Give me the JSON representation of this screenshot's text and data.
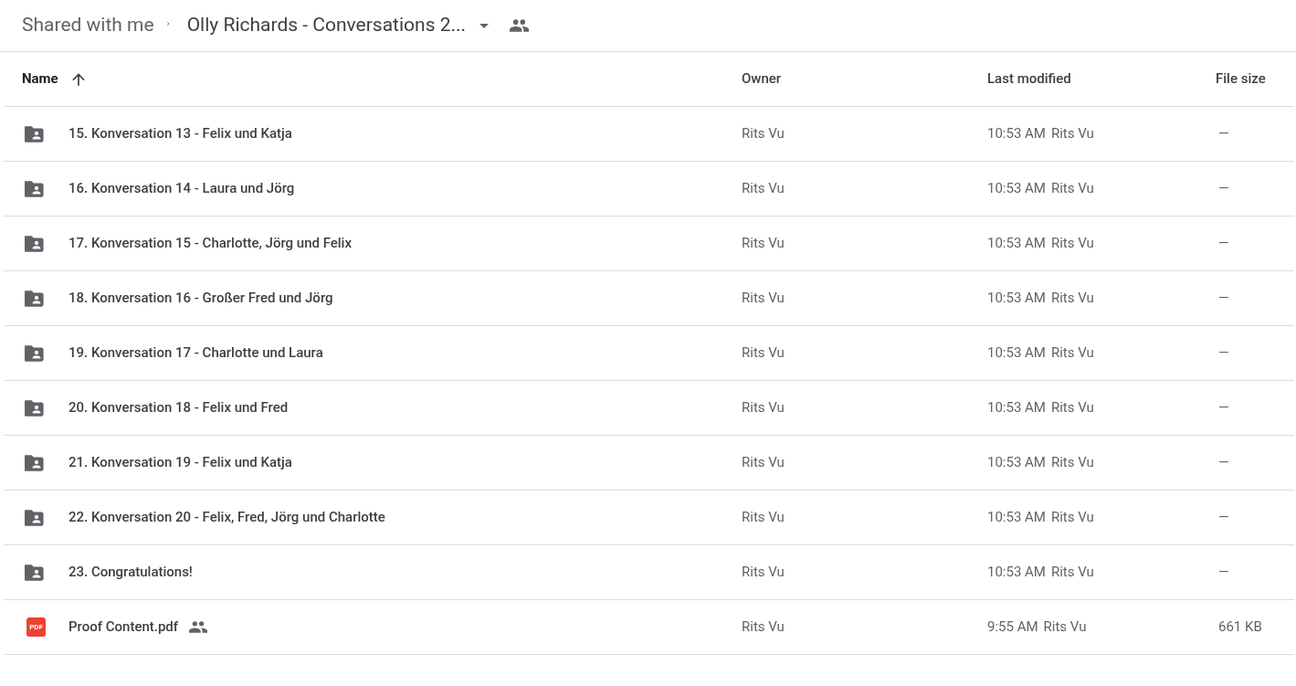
{
  "breadcrumb": {
    "root": "Shared with me",
    "current": "Olly Richards - Conversations 2...",
    "shared": true
  },
  "columns": [
    {
      "label": "Name",
      "sorted": true
    },
    {
      "label": "Owner",
      "sorted": false
    },
    {
      "label": "Last modified",
      "sorted": false
    },
    {
      "label": "File size",
      "sorted": false
    }
  ],
  "rows": [
    {
      "kind": "folder",
      "name": "15. Konversation 13 - Felix und Katja",
      "shared": false,
      "owner": "Rits Vu",
      "modified": "10:53 AM",
      "modified_by": "Rits Vu",
      "size": "—"
    },
    {
      "kind": "folder",
      "name": "16. Konversation 14 - Laura und Jörg",
      "shared": false,
      "owner": "Rits Vu",
      "modified": "10:53 AM",
      "modified_by": "Rits Vu",
      "size": "—"
    },
    {
      "kind": "folder",
      "name": "17. Konversation 15 - Charlotte, Jörg und Felix",
      "shared": false,
      "owner": "Rits Vu",
      "modified": "10:53 AM",
      "modified_by": "Rits Vu",
      "size": "—"
    },
    {
      "kind": "folder",
      "name": "18. Konversation 16 - Großer Fred und Jörg",
      "shared": false,
      "owner": "Rits Vu",
      "modified": "10:53 AM",
      "modified_by": "Rits Vu",
      "size": "—"
    },
    {
      "kind": "folder",
      "name": "19. Konversation 17 - Charlotte und Laura",
      "shared": false,
      "owner": "Rits Vu",
      "modified": "10:53 AM",
      "modified_by": "Rits Vu",
      "size": "—"
    },
    {
      "kind": "folder",
      "name": "20. Konversation 18 - Felix und Fred",
      "shared": false,
      "owner": "Rits Vu",
      "modified": "10:53 AM",
      "modified_by": "Rits Vu",
      "size": "—"
    },
    {
      "kind": "folder",
      "name": "21. Konversation 19 - Felix und Katja",
      "shared": false,
      "owner": "Rits Vu",
      "modified": "10:53 AM",
      "modified_by": "Rits Vu",
      "size": "—"
    },
    {
      "kind": "folder",
      "name": "22. Konversation 20 - Felix, Fred, Jörg und Charlotte",
      "shared": false,
      "owner": "Rits Vu",
      "modified": "10:53 AM",
      "modified_by": "Rits Vu",
      "size": "—"
    },
    {
      "kind": "folder",
      "name": "23. Congratulations!",
      "shared": false,
      "owner": "Rits Vu",
      "modified": "10:53 AM",
      "modified_by": "Rits Vu",
      "size": "—"
    },
    {
      "kind": "pdf",
      "icon_text": "PDF",
      "name": "Proof Content.pdf",
      "shared": true,
      "owner": "Rits Vu",
      "modified": "9:55 AM",
      "modified_by": "Rits Vu",
      "size": "661 KB"
    }
  ]
}
